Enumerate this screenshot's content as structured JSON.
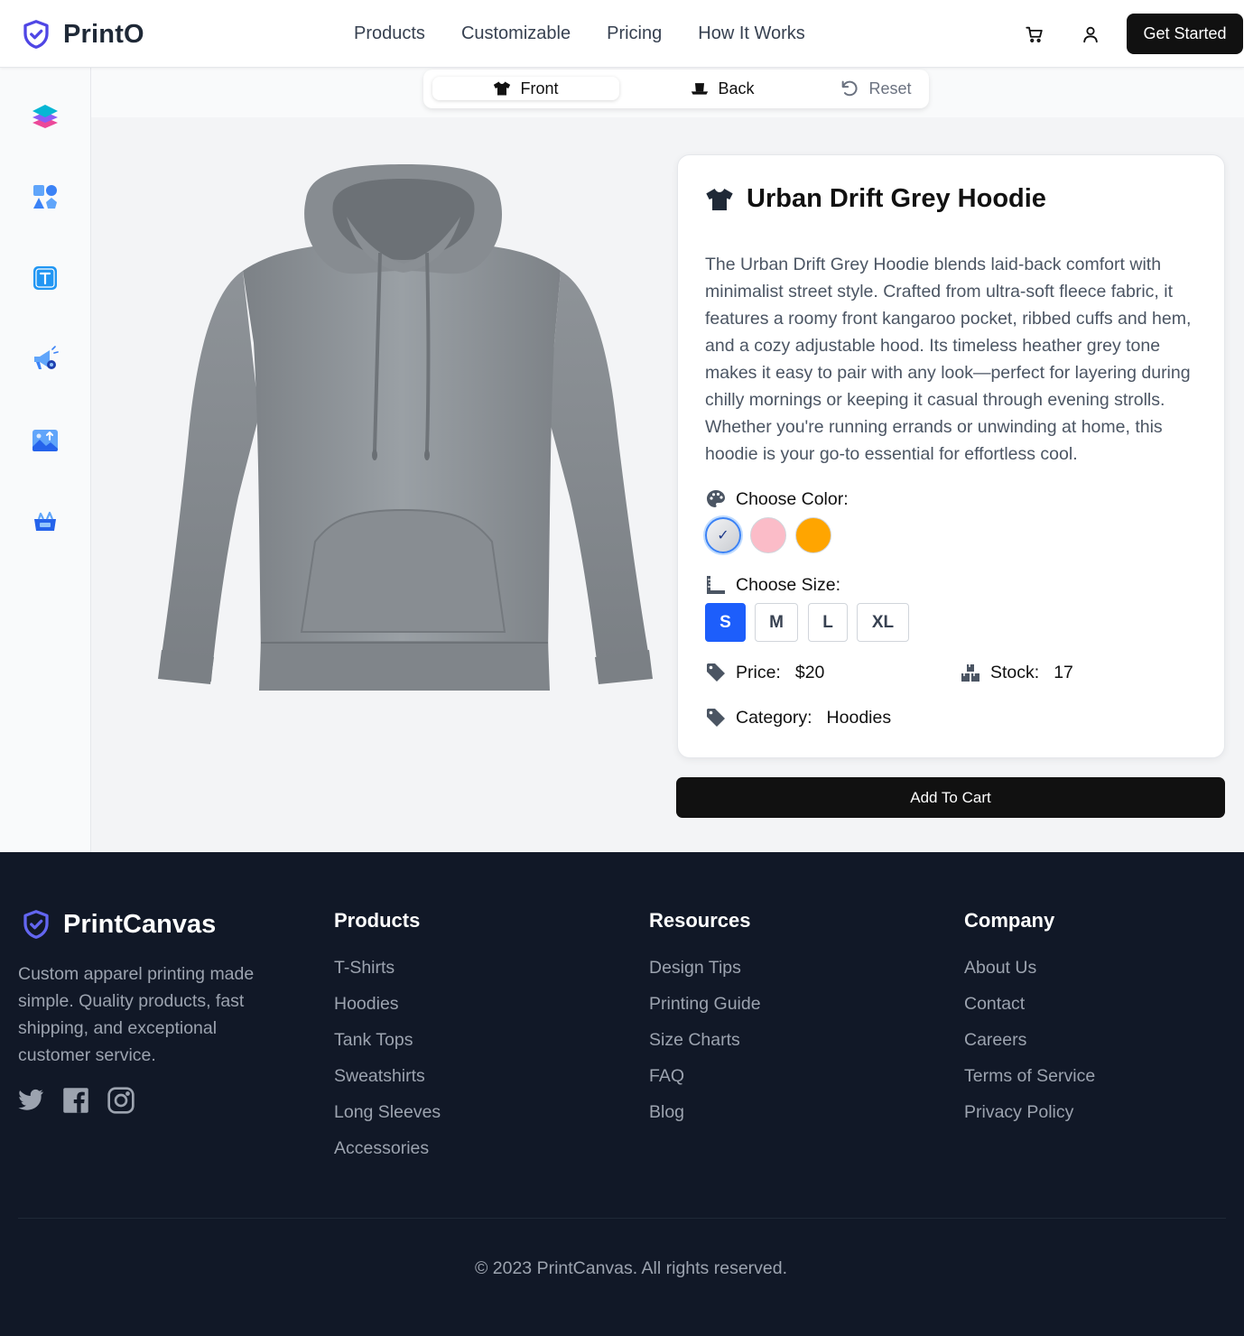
{
  "header": {
    "logo_text": "PrintO",
    "nav": [
      "Products",
      "Customizable",
      "Pricing",
      "How It Works"
    ],
    "cta_label": "Get Started",
    "icons": [
      "cart-icon",
      "user-icon"
    ]
  },
  "sidebar": {
    "tools": [
      "layers-icon",
      "shapes-icon",
      "text-icon",
      "marketing-icon",
      "image-upload-icon",
      "templates-icon"
    ]
  },
  "view_toggle": {
    "front": "Front",
    "back": "Back",
    "reset": "Reset",
    "active": "front"
  },
  "product": {
    "title": "Urban Drift Grey Hoodie",
    "description": "The Urban Drift Grey Hoodie blends laid-back comfort with minimalist street style. Crafted from ultra-soft fleece fabric, it features a roomy front kangaroo pocket, ribbed cuffs and hem, and a cozy adjustable hood. Its timeless heather grey tone makes it easy to pair with any look—perfect for layering during chilly mornings or keeping it casual through evening strolls. Whether you're running errands or unwinding at home, this hoodie is your go-to essential for effortless cool.",
    "choose_color_label": "Choose Color:",
    "colors": [
      {
        "hex": "#e5e7eb",
        "selected": true,
        "check": "✓"
      },
      {
        "hex": "#fbbcc8",
        "selected": false
      },
      {
        "hex": "#ffa500",
        "selected": false
      }
    ],
    "choose_size_label": "Choose Size:",
    "sizes": [
      "S",
      "M",
      "L",
      "XL"
    ],
    "selected_size": "S",
    "price_label": "Price:",
    "price": "$20",
    "stock_label": "Stock:",
    "stock": "17",
    "category_label": "Category:",
    "category": "Hoodies",
    "add_to_cart": "Add To Cart"
  },
  "footer": {
    "brand": "PrintCanvas",
    "about": "Custom apparel printing made simple. Quality products, fast shipping, and exceptional customer service.",
    "social": [
      "twitter-icon",
      "facebook-icon",
      "instagram-icon"
    ],
    "columns": [
      {
        "title": "Products",
        "links": [
          "T-Shirts",
          "Hoodies",
          "Tank Tops",
          "Sweatshirts",
          "Long Sleeves",
          "Accessories"
        ]
      },
      {
        "title": "Resources",
        "links": [
          "Design Tips",
          "Printing Guide",
          "Size Charts",
          "FAQ",
          "Blog"
        ]
      },
      {
        "title": "Company",
        "links": [
          "About Us",
          "Contact",
          "Careers",
          "Terms of Service",
          "Privacy Policy"
        ]
      }
    ],
    "copyright": "© 2023 PrintCanvas. All rights reserved."
  },
  "colors": {
    "brand_purple": "#4f46e5",
    "primary_blue": "#1d5efb",
    "dark": "#111111",
    "footer_bg": "#111827"
  }
}
